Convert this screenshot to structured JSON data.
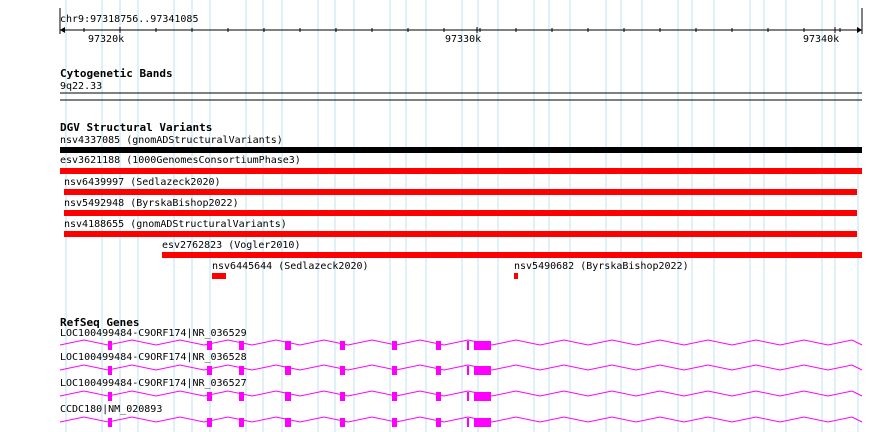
{
  "locus": "chr9:97318756..97341085",
  "ruler": {
    "ticks": [
      "97320k",
      "97330k",
      "97340k"
    ]
  },
  "colors": {
    "grid": "#bfe3f2",
    "variant_black": "#000000",
    "variant_red": "#ff0000",
    "gene": "#ff00ff"
  },
  "tracks": {
    "cytoband": {
      "title": "Cytogenetic Bands",
      "band": "9q22.33"
    },
    "dgv": {
      "title": "DGV Structural Variants",
      "features": [
        {
          "label": "nsv4337085 (gnomADStructuralVariants)",
          "color": "black"
        },
        {
          "label": "esv3621188 (1000GenomesConsortiumPhase3)",
          "color": "red"
        },
        {
          "label": "nsv6439997 (Sedlazeck2020)",
          "color": "red"
        },
        {
          "label": "nsv5492948 (ByrskaBishop2022)",
          "color": "red"
        },
        {
          "label": "nsv4188655 (gnomADStructuralVariants)",
          "color": "red"
        },
        {
          "label": "esv2762823 (Vogler2010)",
          "color": "red"
        },
        {
          "label": "nsv6445644 (Sedlazeck2020)",
          "color": "red"
        },
        {
          "label": "nsv5490682 (ByrskaBishop2022)",
          "color": "red"
        }
      ]
    },
    "refseq": {
      "title": "RefSeq Genes",
      "transcripts": [
        {
          "label": "LOC100499484-C9ORF174|NR_036529"
        },
        {
          "label": "LOC100499484-C9ORF174|NR_036528"
        },
        {
          "label": "LOC100499484-C9ORF174|NR_036527"
        },
        {
          "label": "CCDC180|NM_020893"
        }
      ]
    }
  }
}
